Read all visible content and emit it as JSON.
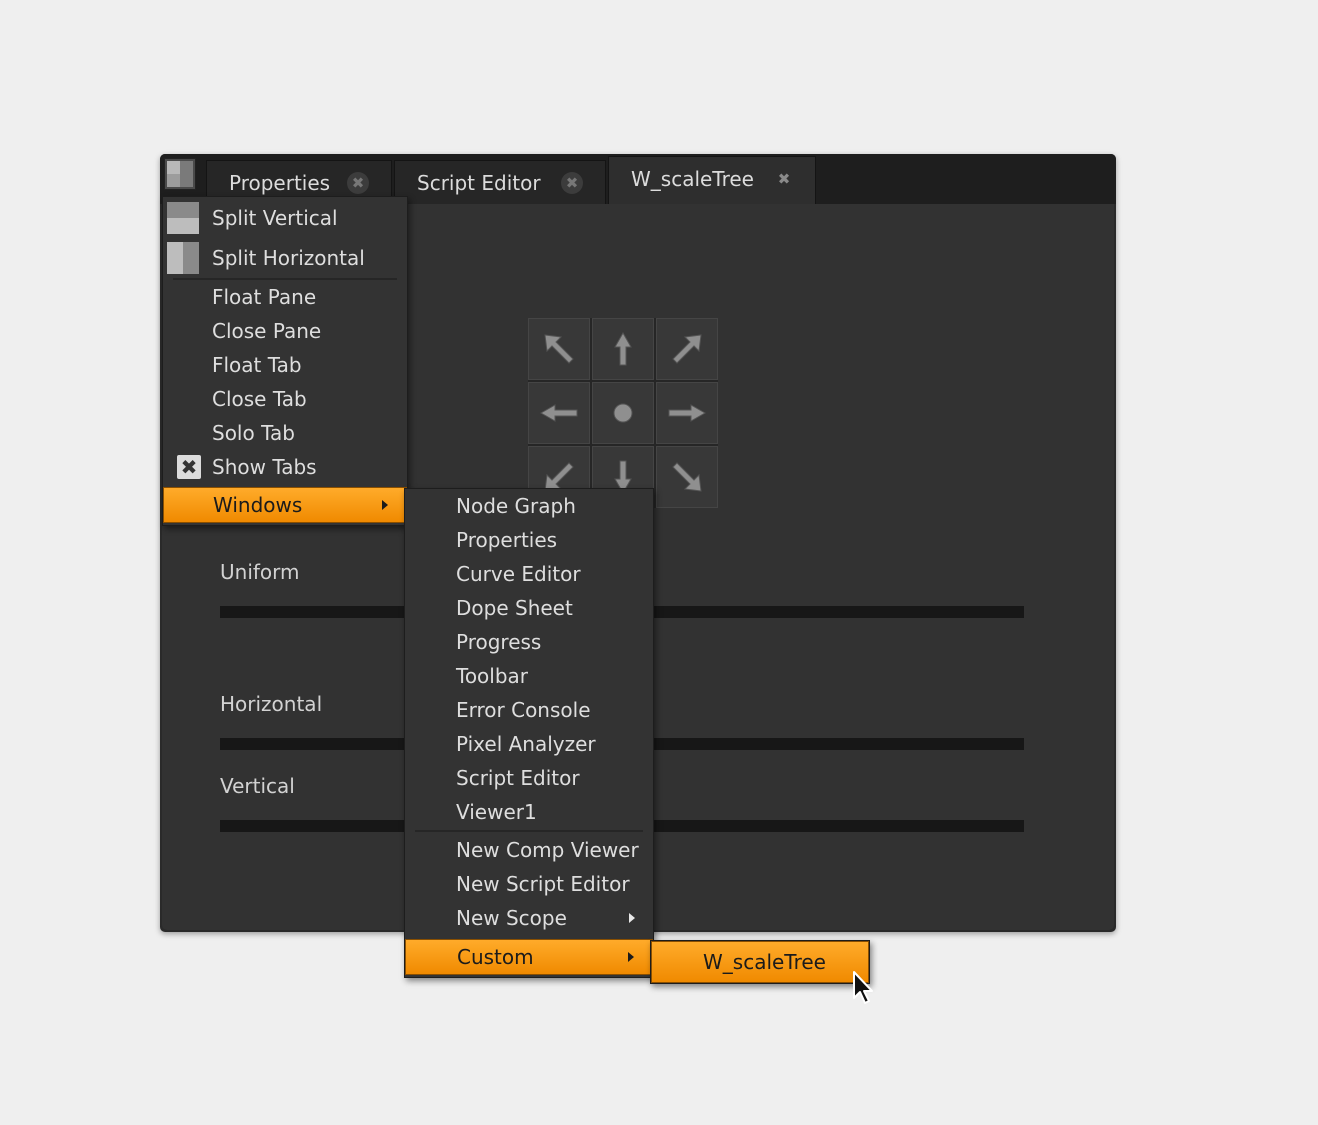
{
  "tabs": [
    {
      "label": "Properties"
    },
    {
      "label": "Script Editor"
    },
    {
      "label": "W_scaleTree"
    }
  ],
  "close_glyph": "✖",
  "params": {
    "uniform": "Uniform",
    "horizontal": "Horizontal",
    "vertical": "Vertical"
  },
  "pane_menu": {
    "split_vertical": "Split Vertical",
    "split_horizontal": "Split Horizontal",
    "float_pane": "Float Pane",
    "close_pane": "Close Pane",
    "float_tab": "Float Tab",
    "close_tab": "Close Tab",
    "solo_tab": "Solo Tab",
    "show_tabs": "Show Tabs",
    "show_tabs_checked": true,
    "check_glyph": "✖",
    "windows": "Windows"
  },
  "windows_menu": {
    "items": [
      "Node Graph",
      "Properties",
      "Curve Editor",
      "Dope Sheet",
      "Progress",
      "Toolbar",
      "Error Console",
      "Pixel Analyzer",
      "Script Editor",
      "Viewer1"
    ],
    "new_comp_viewer": "New Comp Viewer",
    "new_script_editor": "New Script Editor",
    "new_scope": "New Scope",
    "custom": "Custom"
  },
  "custom_menu": {
    "item": "W_scaleTree"
  },
  "colors": {
    "highlight": "#f39a14",
    "panel": "#323232",
    "tabbar": "#1e1e1e",
    "text": "#dedede"
  }
}
